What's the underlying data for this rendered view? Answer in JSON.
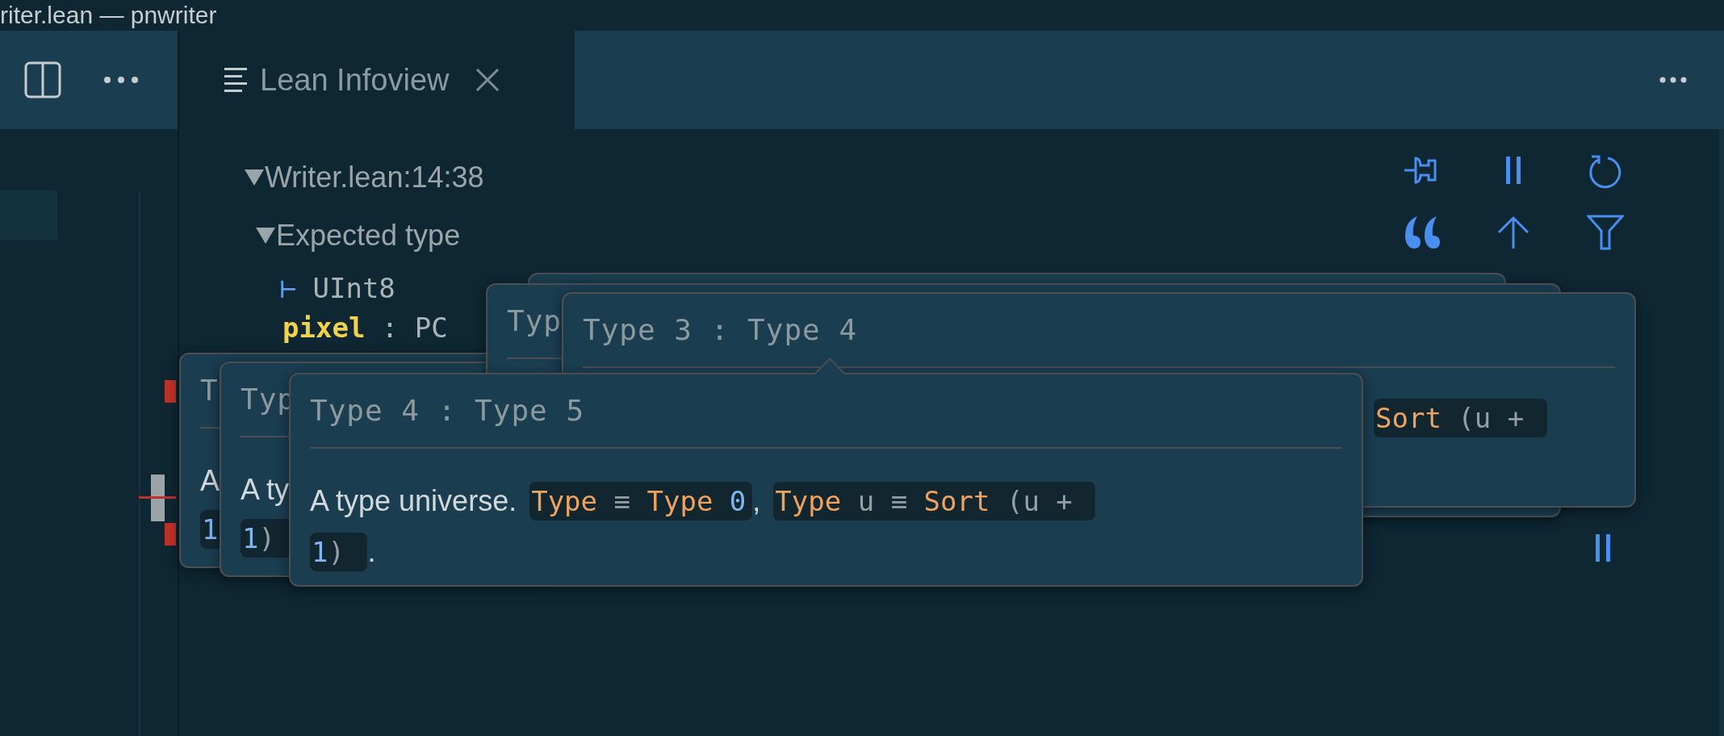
{
  "window": {
    "title": "riter.lean — pnwriter"
  },
  "tab": {
    "label": "Lean Infoview",
    "selected": true
  },
  "infoview": {
    "location": "Writer.lean:14:38",
    "location_expanded": true,
    "section": "Expected type",
    "section_expanded": true,
    "goal_symbol": "⊢",
    "goal": "UInt8",
    "hyp_name": "pixel",
    "hyp_rest": " : PC"
  },
  "popups": [
    {
      "kind": "tooltip",
      "title": "T",
      "lines": [
        [
          {
            "kind": "text",
            "text": "A"
          }
        ],
        [
          {
            "kind": "code",
            "tokens": [
              {
                "kind": "number",
                "text": "1"
              }
            ]
          }
        ]
      ]
    },
    {
      "kind": "tooltip",
      "title": "Typ",
      "lines": [
        [
          {
            "kind": "text",
            "text": "A ty"
          }
        ],
        [
          {
            "kind": "code",
            "tokens": [
              {
                "kind": "number",
                "text": "1"
              },
              {
                "kind": "plain",
                "text": ") "
              }
            ]
          }
        ]
      ]
    },
    {
      "kind": "backdrop"
    },
    {
      "kind": "tooltip",
      "title": "Typ"
    },
    {
      "kind": "tooltip",
      "title": "Type 3 : Type 4",
      "offset": true,
      "lines": [
        [
          {
            "kind": "code",
            "tokens": [
              {
                "kind": "keyword",
                "text": "Sort"
              },
              {
                "kind": "plain",
                "text": " (u + "
              }
            ]
          }
        ]
      ]
    },
    {
      "kind": "tooltip",
      "title": "Type 4 : Type 5",
      "pointer": true,
      "lines": [
        [
          {
            "kind": "text",
            "text": "A type universe. "
          },
          {
            "kind": "code",
            "tokens": [
              {
                "kind": "keyword",
                "text": "Type"
              },
              {
                "kind": "plain",
                "text": " ≡ "
              },
              {
                "kind": "keyword",
                "text": "Type "
              },
              {
                "kind": "number",
                "text": "0"
              }
            ]
          },
          {
            "kind": "text",
            "text": ", "
          },
          {
            "kind": "code",
            "tokens": [
              {
                "kind": "keyword",
                "text": "Type"
              },
              {
                "kind": "plain",
                "text": " u ≡ "
              },
              {
                "kind": "keyword",
                "text": "Sort"
              },
              {
                "kind": "plain",
                "text": " (u + "
              }
            ]
          }
        ],
        [
          {
            "kind": "code",
            "tokens": [
              {
                "kind": "number",
                "text": "1"
              },
              {
                "kind": "plain",
                "text": ") "
              }
            ]
          },
          {
            "kind": "text",
            "text": "."
          }
        ]
      ]
    }
  ]
}
